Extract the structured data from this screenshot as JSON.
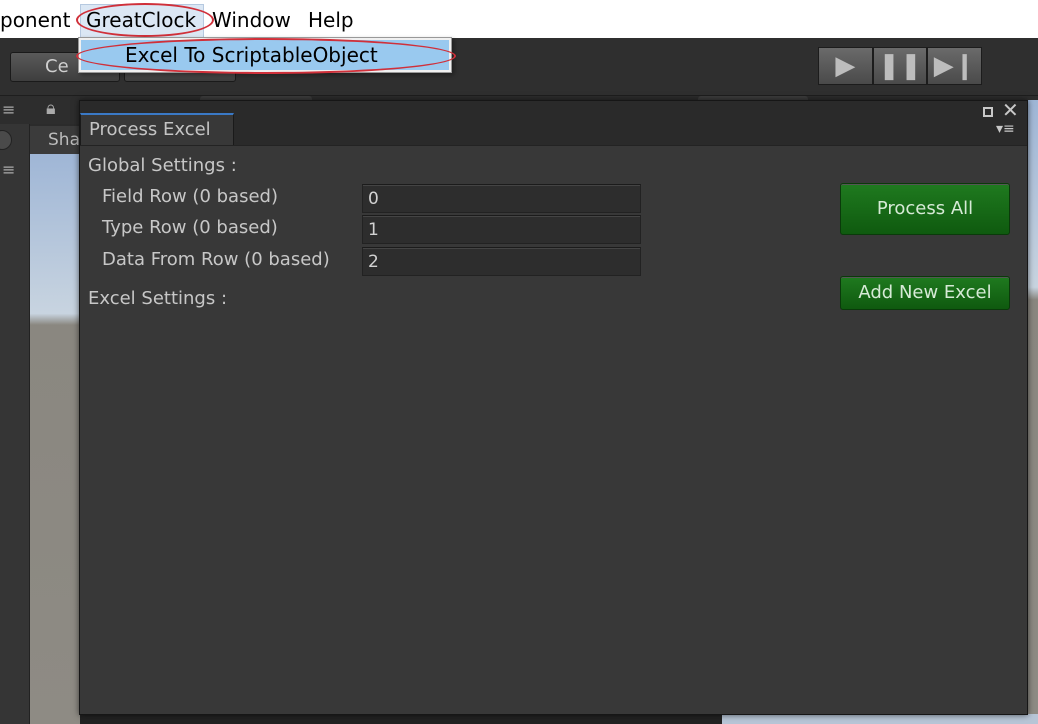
{
  "menubar": {
    "items": [
      {
        "label": "ponent"
      },
      {
        "label": "GreatClock"
      },
      {
        "label": "Window"
      },
      {
        "label": "Help"
      }
    ]
  },
  "dropdown": {
    "items": [
      {
        "label": "Excel To ScriptableObject"
      }
    ]
  },
  "toolbar": {
    "button1_label": "Ce",
    "play_icons": [
      "play-icon",
      "pause-icon",
      "step-icon"
    ]
  },
  "scene": {
    "tab_label": "Sha"
  },
  "editor": {
    "tab_label": "Process Excel",
    "global_settings_label": "Global Settings :",
    "fields": [
      {
        "label": "Field Row (0 based)",
        "value": "0"
      },
      {
        "label": "Type Row (0 based)",
        "value": "1"
      },
      {
        "label": "Data From Row (0 based)",
        "value": "2"
      }
    ],
    "excel_settings_label": "Excel Settings :",
    "process_all_label": "Process All",
    "add_new_excel_label": "Add New Excel"
  },
  "colors": {
    "accent_green": "#1f7a1f",
    "annotation_red": "#d0303a",
    "menu_highlight": "#99c9ef",
    "editor_bg": "#383838"
  }
}
